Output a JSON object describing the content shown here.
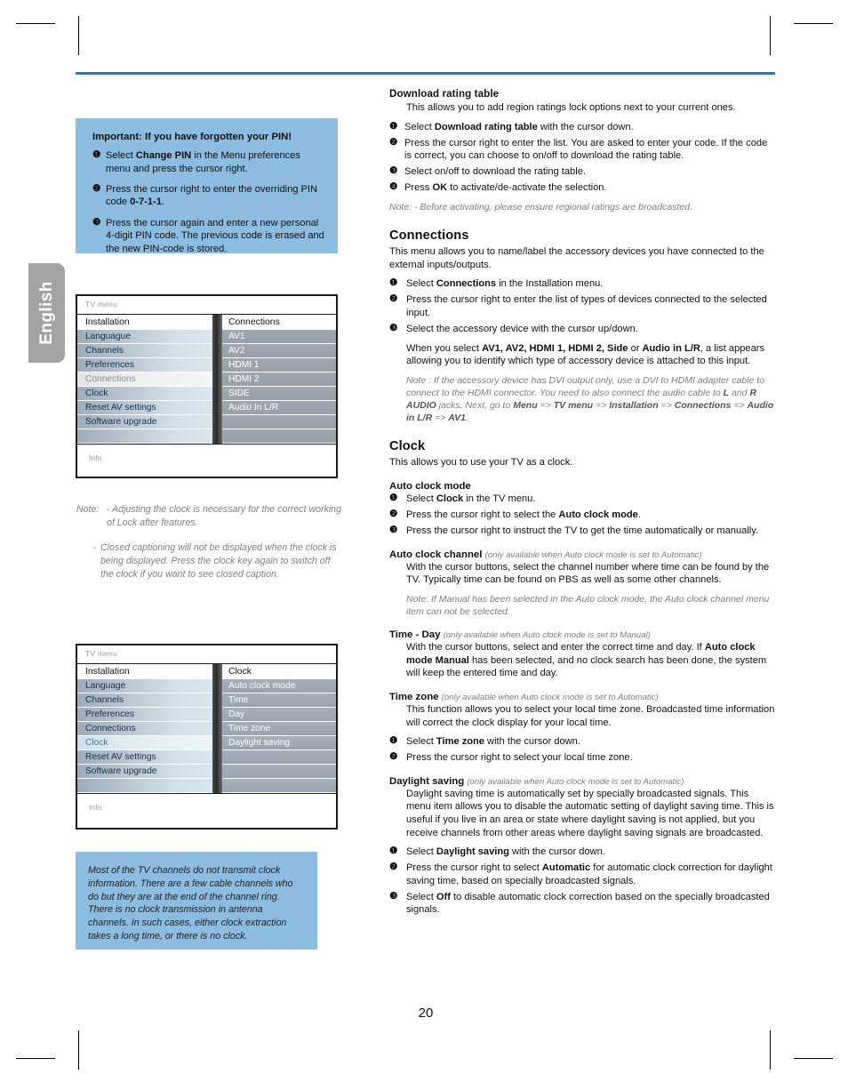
{
  "page": {
    "number": "20",
    "language_tab": "English"
  },
  "pin_box": {
    "title": "Important: If you have forgotten your PIN!",
    "steps": [
      {
        "num": "❶",
        "html": "Select <b>Change PIN</b> in the Menu preferences menu and press the cursor right."
      },
      {
        "num": "❷",
        "html": "Press the cursor right to enter the overriding PIN code <b>0-7-1-1</b>."
      },
      {
        "num": "❸",
        "html": "Press the cursor again and enter a new personal 4-digit PIN code. The previous code is erased and the new PIN-code is stored."
      }
    ]
  },
  "tvmenu_connections": {
    "window_label": "TV menu",
    "info_label": "Info",
    "left_header": "Installation",
    "right_header": "Connections",
    "left_items": [
      "Languague",
      "Channels",
      "Preferences",
      "Connections",
      "Clock",
      "Reset AV settings",
      "Software upgrade",
      ""
    ],
    "left_selected_index": 3,
    "right_items": [
      "AV1",
      "AV2",
      "HDMI 1",
      "HDMI 2",
      "SIDE",
      "Audio In L/R",
      "",
      ""
    ]
  },
  "tvmenu_clock": {
    "window_label": "TV menu",
    "info_label": "Info",
    "left_header": "Installation",
    "right_header": "Clock",
    "left_items": [
      "Language",
      "Channels",
      "Preferences",
      "Connections",
      "Clock",
      "Reset AV settings",
      "Software upgrade",
      ""
    ],
    "left_selected_index": 4,
    "right_items": [
      "Auto clock mode",
      "Time",
      "Day",
      "Time zone",
      "Daylight saving",
      "",
      "",
      ""
    ]
  },
  "left_note": {
    "lead": "Note:",
    "item1": "- Adjusting the clock is necessary for the correct working of Lock after features.",
    "item2_dash": "-",
    "item2": "Closed captioning will not be displayed when the clock is being displayed. Press the clock key again to switch off the clock if you want to see closed caption."
  },
  "clock_box": {
    "text": "Most of the TV channels do not transmit clock information. There are a few cable channels who do but they are at the end of the channel ring. There is no clock transmission in antenna channels. In such cases, either clock extraction takes a long time, or there is no clock."
  },
  "download_rating": {
    "heading": "Download rating table",
    "intro": "This allows you to add region ratings lock options next to your current ones.",
    "steps": [
      {
        "num": "❶",
        "html": "Select <b>Download rating table</b> with the cursor down."
      },
      {
        "num": "❷",
        "html": "Press the cursor right to enter the list. You are asked to enter your code. If the code is correct, you can choose to on/off to download the rating table."
      },
      {
        "num": "❸",
        "html": "Select on/off to download the rating table."
      },
      {
        "num": "❹",
        "html": "Press <b>OK</b> to activate/de-activate the selection."
      }
    ],
    "note": "Note: - Before activating, please ensure regional ratings are broadcasted."
  },
  "connections": {
    "heading": "Connections",
    "intro": "This menu allows you to name/label the accessory devices you have connected to the external inputs/outputs.",
    "steps": [
      {
        "num": "❶",
        "html": "Select <b>Connections</b> in the Installation menu."
      },
      {
        "num": "❷",
        "html": "Press the cursor right to enter the list of types of devices connected to the selected input."
      },
      {
        "num": "❸",
        "html": "Select the accessory device with the cursor up/down."
      }
    ],
    "para": "When you select <b>AV1, AV2, HDMI 1, HDMI 2, Side</b> or <b>Audio in L/R</b>, a list appears allowing you to identify which type of accessory device is attached to this input.",
    "note": "Note : If the accessory device has DVI output only, use a DVI to HDMI adapter cable to connect to the HDMI connector. You need to also connect the audio cable to <b>L</b> and <b>R AUDIO</b> jacks. Next, go to <b>Menu</b> => <b>TV menu</b> => <b>Installation</b> => <b>Connections</b> => <b>Audio in L/R</b> => <b>AV1</b>."
  },
  "clock": {
    "heading": "Clock",
    "intro": "This allows you to use your TV as a clock.",
    "auto_clock_mode": {
      "heading": "Auto clock mode",
      "steps": [
        {
          "num": "❶",
          "html": "Select <b>Clock</b> in the TV menu."
        },
        {
          "num": "❷",
          "html": "Press the cursor right to select the <b>Auto clock mode</b>."
        },
        {
          "num": "❸",
          "html": "Press the cursor right to instruct the TV to get the time automatically or manually."
        }
      ]
    },
    "auto_clock_channel": {
      "heading": "Auto clock channel",
      "condition": "(only available when Auto clock mode is set to Automatic)",
      "body": "With the cursor buttons, select the channel number where time can be found by the TV. Typically time can be found on PBS as well as some other channels.",
      "note": "Note: If Manual has been selected in the Auto clock mode, the Auto clock channel menu item can not be selected."
    },
    "time_day": {
      "heading": "Time - Day",
      "condition": "(only available when Auto clock mode is set to Manual)",
      "body": "With the cursor buttons, select and enter the correct time and day. If <b>Auto clock mode Manual</b> has been selected, and no clock search has been done, the system will keep the entered time and day."
    },
    "time_zone": {
      "heading": "Time zone",
      "condition": "(only available when Auto clock mode is set to Automatic)",
      "body": "This function allows you to select your local time zone. Broadcasted time information will correct the clock display for your local time.",
      "steps": [
        {
          "num": "❶",
          "html": "Select <b>Time zone</b> with the cursor down."
        },
        {
          "num": "❷",
          "html": "Press the cursor right to select your local time zone."
        }
      ]
    },
    "daylight_saving": {
      "heading": "Daylight saving",
      "condition": "(only available when Auto clock mode is set to Automatic)",
      "body": "Daylight saving time is automatically set by specially broadcasted signals. This menu item allows you to disable the automatic setting of daylight saving time. This is useful if you live in an area or state where daylight saving is not applied, but you receive channels from other areas where daylight saving signals are broadcasted.",
      "steps": [
        {
          "num": "❶",
          "html": "Select <b>Daylight saving</b> with the cursor down."
        },
        {
          "num": "❷",
          "html": "Press the cursor right to select <b>Automatic</b> for automatic clock correction for daylight saving time, based on specially broadcasted signals."
        },
        {
          "num": "❸",
          "html": "Select <b>Off</b> to disable automatic clock correction based on the specially broadcasted signals."
        }
      ]
    }
  },
  "colors": {
    "rule": "#1a7ec2",
    "panel": "#8cbce0",
    "tab": "#a3a3a3"
  }
}
